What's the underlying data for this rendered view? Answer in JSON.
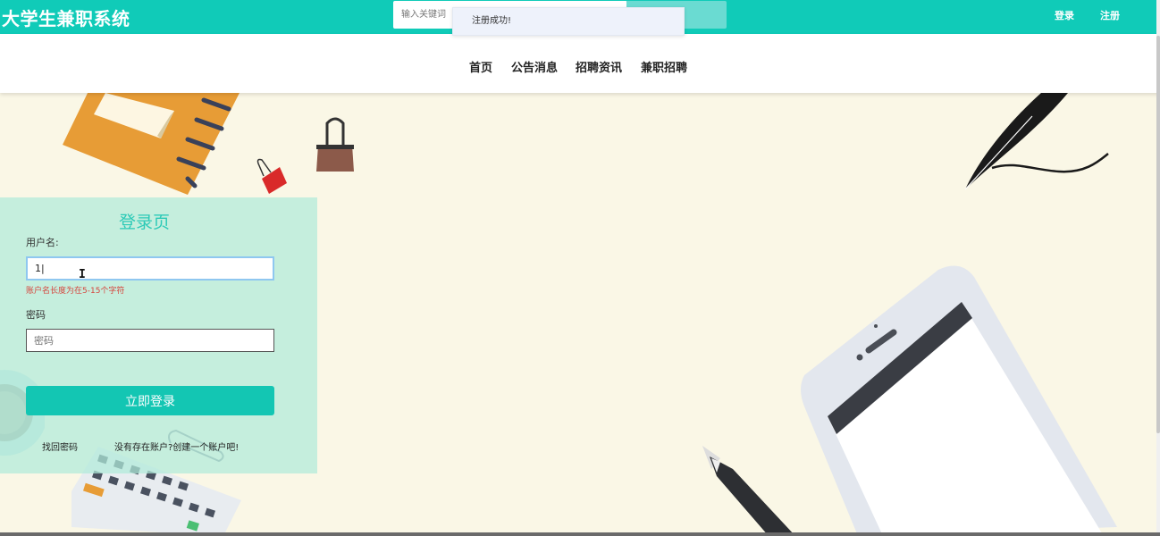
{
  "app": {
    "title": "大学生兼职系统"
  },
  "search": {
    "placeholder": "输入关键词"
  },
  "toast": {
    "message": "注册成功!"
  },
  "top_links": {
    "login": "登录",
    "register": "注册"
  },
  "nav": {
    "items": [
      "首页",
      "公告消息",
      "招聘资讯",
      "兼职招聘"
    ]
  },
  "login_form": {
    "title": "登录页",
    "username_label": "用户名:",
    "username_value": "1|",
    "username_error": "账户名长度为在5-15个字符",
    "password_label": "密码",
    "password_placeholder": "密码",
    "submit_label": "立即登录",
    "forgot_password": "找回密码",
    "create_account": "没有存在账户?创建一个账户吧!"
  },
  "colors": {
    "primary": "#10cbb8",
    "background": "#faf7e6",
    "error": "#d6453d"
  },
  "icons": [
    "notebook-illustration",
    "binder-clip-icon",
    "feather-pen-icon",
    "smartphone-illustration",
    "pen-illustration",
    "calculator-illustration",
    "paper-clip-icon",
    "text-cursor-icon"
  ]
}
